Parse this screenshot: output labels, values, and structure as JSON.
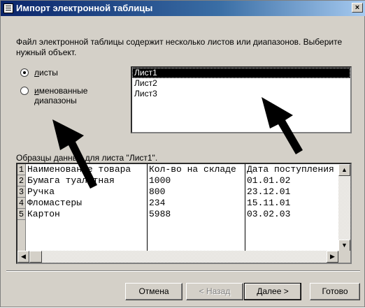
{
  "window": {
    "title": "Импорт электронной таблицы",
    "close_label": "×"
  },
  "description": "Файл электронной таблицы содержит несколько листов или диапазонов. Выберите нужный объект.",
  "options": {
    "sheets": {
      "hotkey": "л",
      "rest": "исты",
      "checked": true
    },
    "ranges": {
      "hotkey": "и",
      "rest": "менованные",
      "line2": "диапазоны",
      "checked": false
    }
  },
  "sheet_list": {
    "items": [
      "Лист1",
      "Лист2",
      "Лист3"
    ],
    "selected": "Лист1"
  },
  "sample": {
    "label": "Образцы данных для листа \"Лист1\".",
    "columns": [
      "Наименование товара",
      "Кол-во на складе",
      "Дата поступления"
    ],
    "rows": [
      {
        "num": "1",
        "cells": [
          "Наименование товара",
          "Кол-во на складе",
          "Дата поступления"
        ]
      },
      {
        "num": "2",
        "cells": [
          "Бумага туалетная",
          "1000",
          "01.01.02"
        ]
      },
      {
        "num": "3",
        "cells": [
          "Ручка",
          "800",
          "23.12.01"
        ]
      },
      {
        "num": "4",
        "cells": [
          "Фломастеры",
          "234",
          "15.11.01"
        ]
      },
      {
        "num": "5",
        "cells": [
          "Картон",
          "5988",
          "03.02.03"
        ]
      }
    ]
  },
  "buttons": {
    "cancel": "Отмена",
    "back": "< Назад",
    "next": "Далее >",
    "finish": "Готово"
  },
  "icons": {
    "window_icon": "spreadsheet-icon",
    "up": "arrow-up-icon",
    "down": "arrow-down-icon",
    "left": "arrow-left-icon",
    "right": "arrow-right-icon"
  },
  "colors": {
    "titlebar": "#0a246a",
    "face": "#d4d0c8",
    "selection": "#000000"
  }
}
